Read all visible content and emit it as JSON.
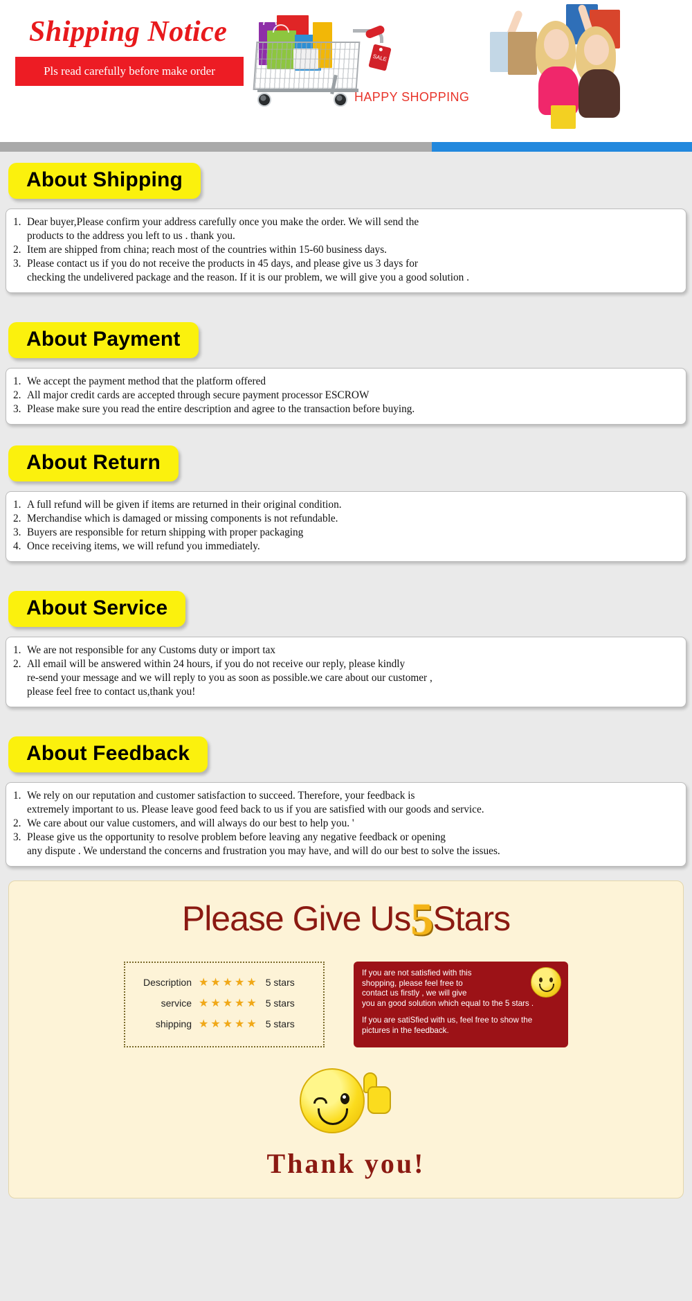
{
  "header": {
    "title": "Shipping Notice",
    "banner_text": "Pls read carefully before make order",
    "happy_shopping": "HAPPY SHOPPING",
    "sale_tag": "SALE",
    "accent_red": "#ed1c24",
    "divider_blue": "#2288dd",
    "divider_gray": "#a9a9a9"
  },
  "sections": [
    {
      "tag": "About Shipping",
      "items": [
        {
          "num": "1.",
          "text": "Dear buyer,Please confirm your address carefully once you make the order. We will send the\nproducts to the address you left to us . thank you."
        },
        {
          "num": "2.",
          "text": "Item are shipped from china; reach most of the countries within 15-60 business days."
        },
        {
          "num": "3.",
          "text": "Please contact us if you do not receive the products in 45 days, and please give us 3 days for\nchecking the undelivered package and the reason. If it is our problem, we will give you a good solution ."
        }
      ]
    },
    {
      "tag": "About Payment",
      "items": [
        {
          "num": "1.",
          "text": "We accept the payment method that the platform offered"
        },
        {
          "num": "2.",
          "text": "All major credit cards are accepted through secure payment processor ESCROW"
        },
        {
          "num": "3.",
          "text": "Please make sure you read the entire description and agree to the transaction before buying."
        }
      ]
    },
    {
      "tag": "About Return",
      "items": [
        {
          "num": "1.",
          "text": "A full refund will be given if items are returned in their original condition."
        },
        {
          "num": "2.",
          "text": "Merchandise which is damaged or missing components is not refundable."
        },
        {
          "num": "3.",
          "text": "Buyers are responsible for return shipping with proper packaging"
        },
        {
          "num": "4.",
          "text": "Once receiving items, we will refund you immediately."
        }
      ]
    },
    {
      "tag": "About Service",
      "items": [
        {
          "num": "1.",
          "text": "We are not responsible for any Customs duty or import tax"
        },
        {
          "num": "2.",
          "text": "All email will be answered within 24 hours, if you do not receive our reply, please kindly\nre-send your message and we will reply to you as soon as possible.we care about our customer ,\nplease feel free to contact us,thank you!"
        }
      ]
    },
    {
      "tag": "About Feedback",
      "items": [
        {
          "num": "1.",
          "text": "We rely on our reputation and customer satisfaction to succeed. Therefore, your feedback is\nextremely important to us. Please leave good feed back to us if you are satisfied with our goods and service."
        },
        {
          "num": "2.",
          "text": "We care about our value customers, and will always do our best to help you. '"
        },
        {
          "num": "3.",
          "text": "Please give us the opportunity to resolve problem before leaving any negative feedback or opening\nany dispute . We understand the concerns and frustration you may have, and will do our best to solve the issues."
        }
      ]
    }
  ],
  "footer": {
    "title_before": "Please Give Us",
    "title_number": "5",
    "title_after": "Stars",
    "ratings": [
      {
        "label": "Description",
        "stars": "★★★★★",
        "value": "5 stars"
      },
      {
        "label": "service",
        "stars": "★★★★★",
        "value": "5 stars"
      },
      {
        "label": "shipping",
        "stars": "★★★★★",
        "value": "5 stars"
      }
    ],
    "message_1": "If you are not satisfied with this\nshopping, please feel free to\ncontact us firstly , we will give\nyou an good solution which equal to the 5 stars .",
    "message_2": "If you are satiSfied with us, feel free to show the\npictures in the feedback.",
    "thank_you": "Thank  you!",
    "panel_bg": "#fdf3d7",
    "title_color": "#8b1a12",
    "msg_bg": "#9c1217",
    "star_color": "#f0a818"
  }
}
